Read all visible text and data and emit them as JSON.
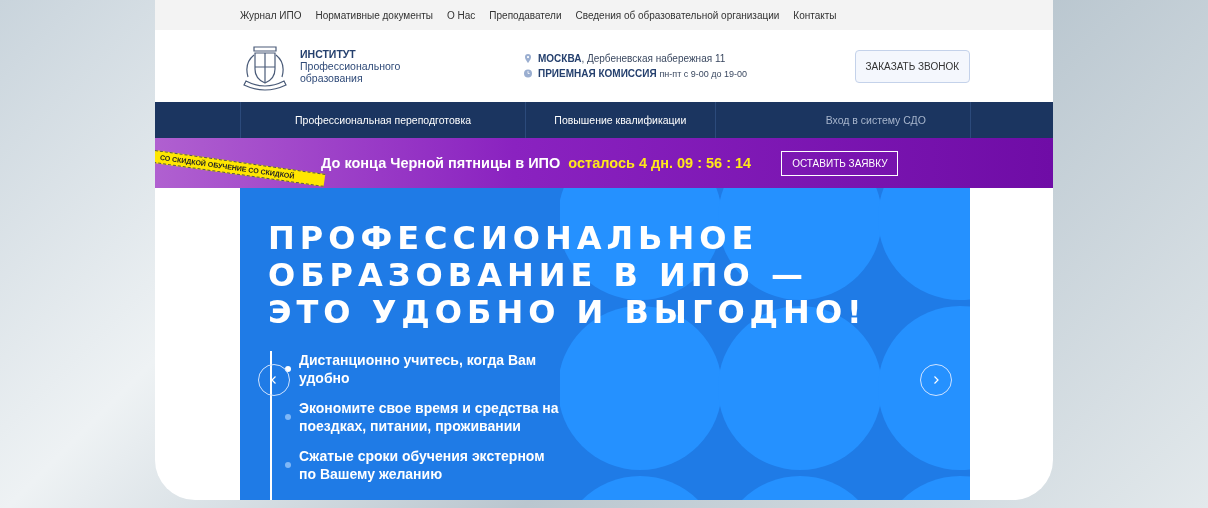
{
  "top_menu": [
    {
      "label": "Журнал ИПО"
    },
    {
      "label": "Нормативные документы"
    },
    {
      "label": "О Нас"
    },
    {
      "label": "Преподаватели"
    },
    {
      "label": "Сведения об образовательной организации"
    },
    {
      "label": "Контакты"
    }
  ],
  "header": {
    "brand_title": "ИНСТИТУТ",
    "brand_subtitle": "Профессионального образования",
    "city": "МОСКВА",
    "address": ", Дербеневская набережная 11",
    "admissions_label": "ПРИЕМНАЯ КОМИССИЯ",
    "admissions_hours": "пн-пт с 9-00 до 19-00",
    "call_button": "ЗАКАЗАТЬ ЗВОНОК"
  },
  "nav": [
    {
      "label": "Профессиональная переподготовка",
      "dimmed": false
    },
    {
      "label": "Повышение квалификации",
      "dimmed": false
    },
    {
      "label": "Вход в систему СДО",
      "dimmed": true
    }
  ],
  "promo": {
    "tape": "СО СКИДКОЙ ОБУЧЕНИЕ СО СКИДКОЙ",
    "text": "До конца Черной пятницы в ИПО",
    "countdown": "осталось 4 дн. 09 : 56 : 14",
    "button": "ОСТАВИТЬ ЗАЯВКУ"
  },
  "hero": {
    "title_lines": [
      "ПРОФЕССИОНАЛЬНОЕ",
      "ОБРАЗОВАНИЕ В ИПО —",
      "ЭТО УДОБНО И ВЫГОДНО!"
    ],
    "bullets": [
      {
        "text": "Дистанционно учитесь, когда Вам удобно",
        "selected": true
      },
      {
        "text": "Экономите свое время и средства на поездках, питании, проживании",
        "selected": false
      },
      {
        "text": "Сжатые сроки обучения экстерном по Вашему желанию",
        "selected": false
      }
    ]
  }
}
